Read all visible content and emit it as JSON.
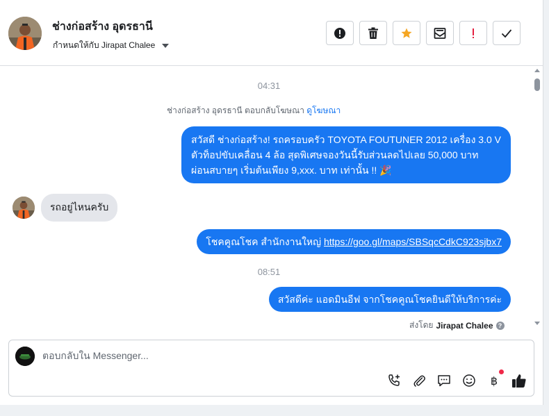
{
  "header": {
    "contact_name": "ช่างก่อสร้าง อุดรธานี",
    "assign_label": "กำหนดให้กับ Jirapat Chalee"
  },
  "actions": [
    {
      "name": "spam-button",
      "icon": "alert-circle-icon"
    },
    {
      "name": "delete-button",
      "icon": "trash-icon"
    },
    {
      "name": "star-button",
      "icon": "star-icon"
    },
    {
      "name": "mark-unread-button",
      "icon": "envelope-icon"
    },
    {
      "name": "follow-up-button",
      "icon": "exclamation-icon"
    },
    {
      "name": "done-button",
      "icon": "check-icon"
    }
  ],
  "colors": {
    "accent": "#1877f2",
    "star": "#f5a623",
    "follow_up": "#e41e3f",
    "incoming_bubble": "#e4e6eb"
  },
  "thread": {
    "time_1": "04:31",
    "ad_note_prefix": "ช่างก่อสร้าง อุดรธานี ตอบกลับโฆษณา",
    "ad_link": "ดูโฆษณา",
    "msg_1_line_1": "สวัสดี ช่างก่อสร้าง! รถครอบครัว TOYOTA FOUTUNER 2012 เครื่อง 3.0 V",
    "msg_1_line_2": "ตัวท็อปขับเคลื่อน 4 ล้อ สุดพิเศษจองวันนี้รับส่วนลดไปเลย 50,000 บาท",
    "msg_1_line_3": "ผ่อนสบายๆ เริ่มต้นเพียง 9,xxx. บาท เท่านั้น !! 🎉",
    "msg_2": "รถอยู่ไหนครับ",
    "msg_3_prefix": "โชคคูณโชค สำนักงานใหญ่",
    "msg_3_link": "https://goo.gl/maps/SBSqcCdkC923sjbx7",
    "time_2": "08:51",
    "msg_4": "สวัสดีค่ะ แอดมินอีฟ จากโชคคูณโชคยินดีให้บริการค่ะ",
    "sent_by_prefix": "ส่งโดย",
    "sent_by_name": "Jirapat Chalee",
    "help_glyph": "?"
  },
  "composer": {
    "placeholder": "ตอบกลับใน Messenger...",
    "baht_glyph": "฿"
  }
}
